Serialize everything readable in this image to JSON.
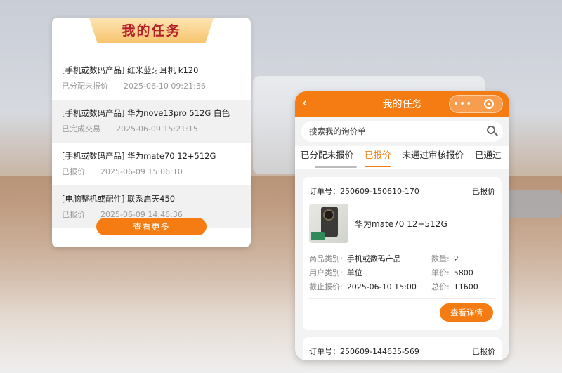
{
  "left_card": {
    "title": "我的任务",
    "tasks": [
      {
        "title": "[手机或数码产品] 红米蓝牙耳机 k120",
        "status": "已分配未报价",
        "time": "2025-06-10 09:21:36"
      },
      {
        "title": "[手机或数码产品] 华为nove13pro 512G 白色",
        "status": "已完成交易",
        "time": "2025-06-09 15:21:15"
      },
      {
        "title": "[手机或数码产品] 华为mate70 12+512G",
        "status": "已报价",
        "time": "2025-06-09 15:06:10"
      },
      {
        "title": "[电脑整机或配件] 联系启天450",
        "status": "已报价",
        "time": "2025-06-09 14:46:36"
      }
    ],
    "more_label": "查看更多"
  },
  "phone": {
    "header": {
      "title": "我的任务",
      "back_icon": "chevron-left-icon",
      "menu_dots": "•••"
    },
    "search": {
      "placeholder": "搜索我的询价单"
    },
    "tabs": [
      "已分配未报价",
      "已报价",
      "未通过审核报价",
      "已通过"
    ],
    "active_tab": 1,
    "order": {
      "order_label": "订单号：250609-150610-170",
      "status": "已报价",
      "product_name": "华为mate70 12+512G",
      "fields": {
        "category_k": "商品类别:",
        "category_v": "手机或数码产品",
        "qty_k": "数量:",
        "qty_v": "2",
        "user_type_k": "用户类别:",
        "user_type_v": "单位",
        "unit_price_k": "单价:",
        "unit_price_v": "5800",
        "deadline_k": "截止报价:",
        "deadline_v": "2025-06-10 15:00",
        "total_k": "总价:",
        "total_v": "11600"
      },
      "detail_label": "查看详情"
    },
    "order2": {
      "order_label": "订单号：250609-144635-569",
      "status": "已报价"
    }
  },
  "colors": {
    "accent": "#f57c12",
    "title_red": "#b3202a"
  }
}
